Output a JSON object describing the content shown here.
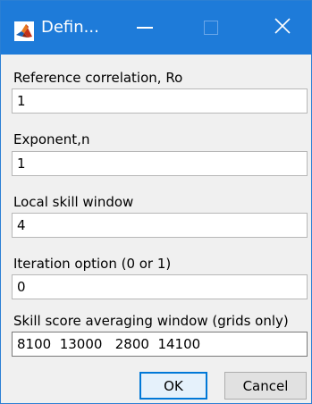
{
  "window": {
    "title": "Defin...",
    "accent_color": "#1e7bd9",
    "icon": "matlab-icon",
    "controls": {
      "minimize_icon": "minimize-icon",
      "maximize_icon": "maximize-icon",
      "close_icon": "close-icon",
      "close_glyph": "✕"
    }
  },
  "fields": [
    {
      "label": "Reference correlation, Ro",
      "value": "1"
    },
    {
      "label": "Exponent,n",
      "value": "1"
    },
    {
      "label": "Local skill window",
      "value": "4"
    },
    {
      "label": "Iteration option (0 or 1)",
      "value": "0"
    },
    {
      "label": "Skill score averaging window (grids only)",
      "value": "8100  13000   2800  14100"
    }
  ],
  "buttons": {
    "ok_label": "OK",
    "cancel_label": "Cancel"
  }
}
